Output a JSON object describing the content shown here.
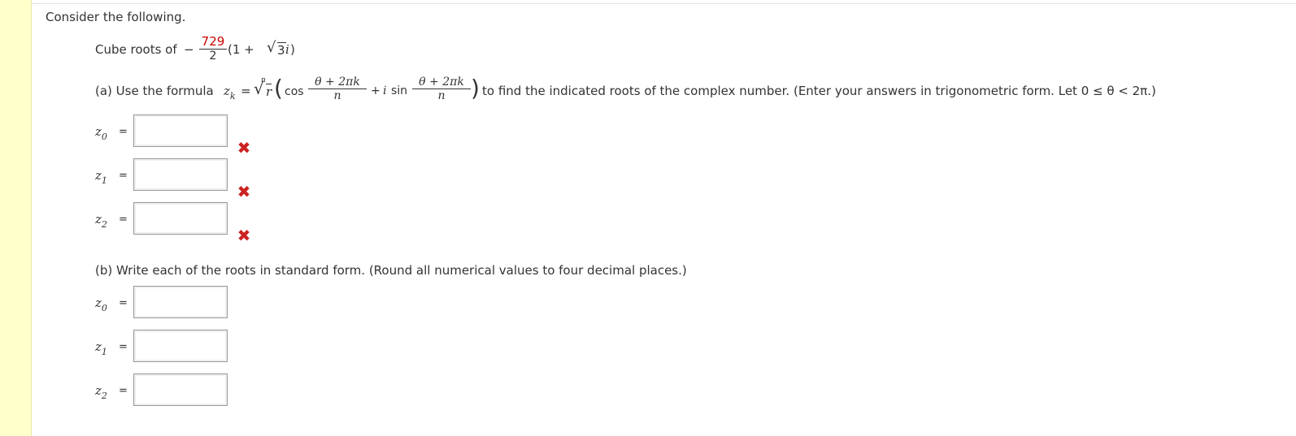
{
  "intro": "Consider the following.",
  "problem": {
    "label": "Cube roots of",
    "minus": "−",
    "coef_num": "729",
    "coef_den": "2",
    "rest_open": "(1 + ",
    "sqrt_symbol": "√",
    "sqrt_arg": "3",
    "imag": "i",
    "rest_close": ")"
  },
  "part_a": {
    "prefix": "(a) Use the formula ",
    "z": "z",
    "k": "k",
    "equals": "=",
    "root_index": "n",
    "radical": "√",
    "r": "r",
    "cos": "cos",
    "frac_num": "θ + 2πk",
    "frac_den": "n",
    "plus_i": "+ ",
    "i": "i",
    "sin": "sin",
    "suffix": "to find the indicated roots of the complex number. (Enter your answers in trigonometric form. Let 0 ≤ θ < 2π.)",
    "answers": [
      {
        "var": "z",
        "sub": "0",
        "eq": "=",
        "value": "",
        "status": "incorrect"
      },
      {
        "var": "z",
        "sub": "1",
        "eq": "=",
        "value": "",
        "status": "incorrect"
      },
      {
        "var": "z",
        "sub": "2",
        "eq": "=",
        "value": "",
        "status": "incorrect"
      }
    ],
    "incorrect_mark": "✖"
  },
  "part_b": {
    "prompt": "(b) Write each of the roots in standard form. (Round all numerical values to four decimal places.)",
    "answers": [
      {
        "var": "z",
        "sub": "0",
        "eq": "=",
        "value": ""
      },
      {
        "var": "z",
        "sub": "1",
        "eq": "=",
        "value": ""
      },
      {
        "var": "z",
        "sub": "2",
        "eq": "=",
        "value": ""
      }
    ]
  },
  "colors": {
    "strip": "#ffffcc",
    "incorrect": "#cc2222",
    "highlight_number": "#cc0000"
  }
}
